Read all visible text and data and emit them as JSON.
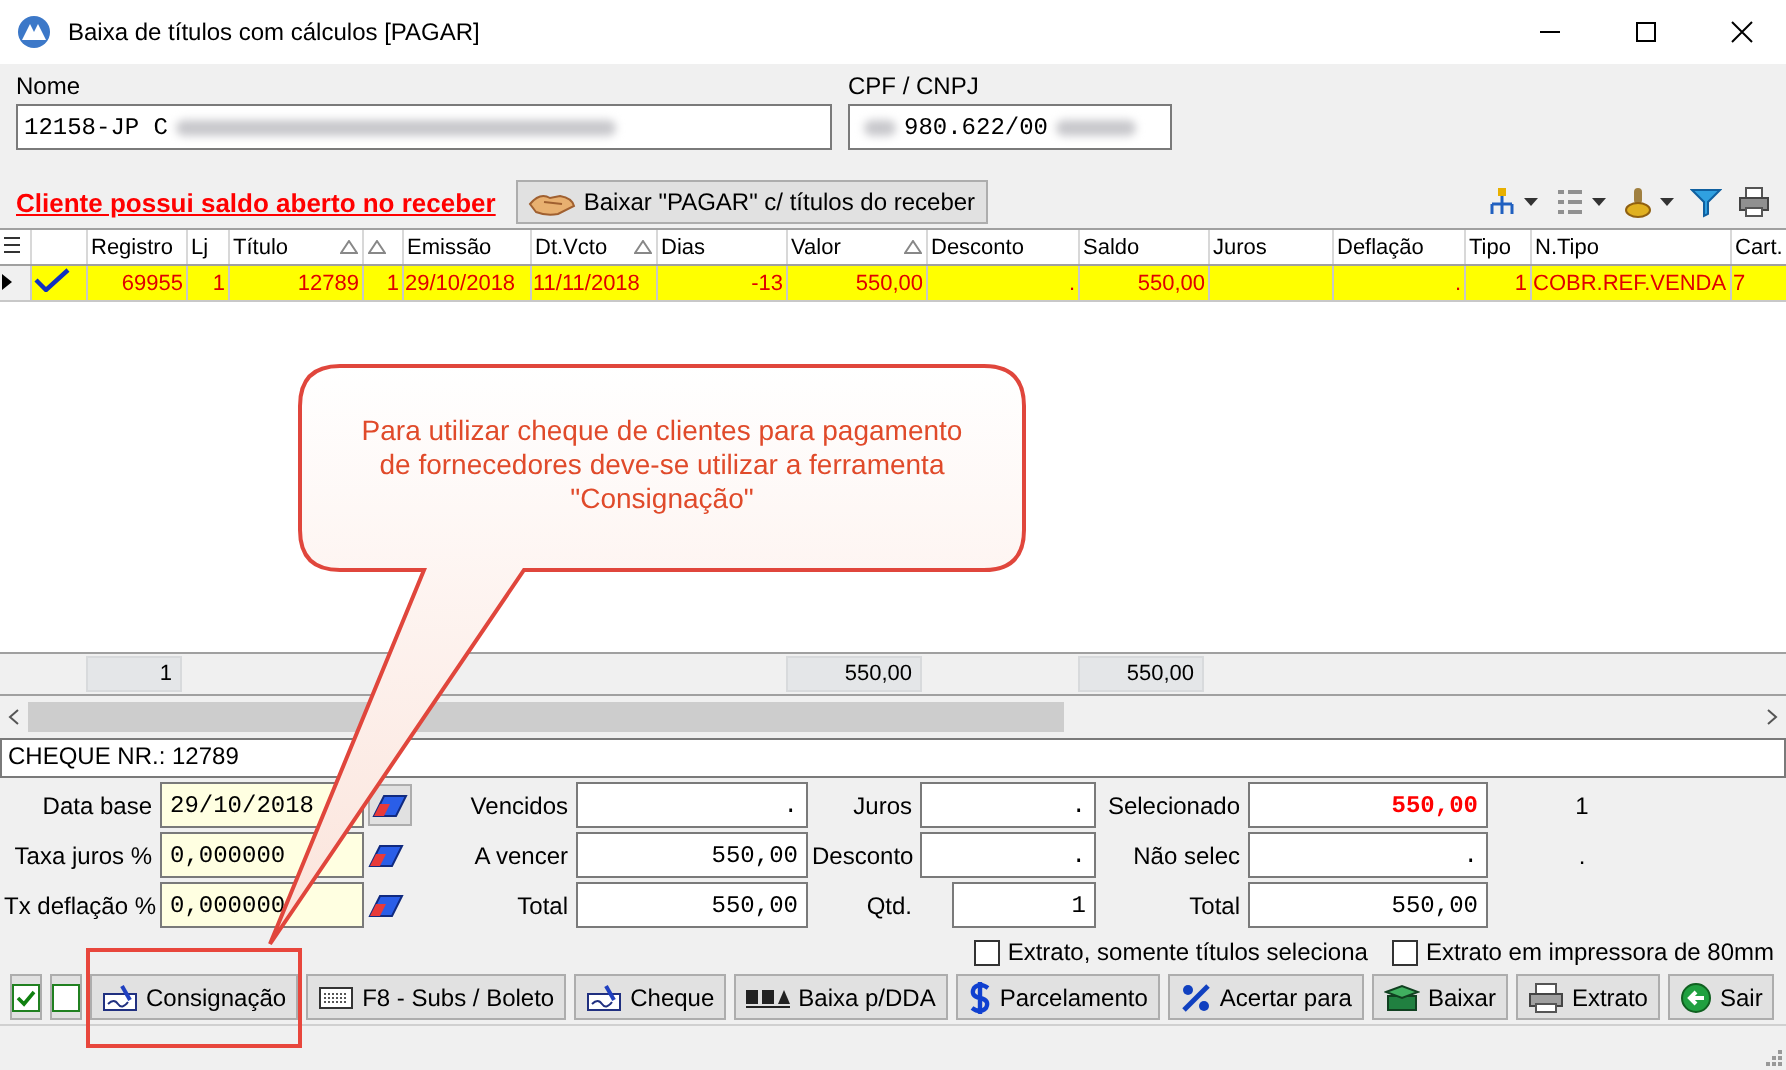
{
  "window": {
    "title": "Baixa de títulos com cálculos [PAGAR]"
  },
  "customer": {
    "name_label": "Nome",
    "name_value": "12158-JP C",
    "id_label": "CPF / CNPJ",
    "id_value": "980.622/00"
  },
  "alert": "Cliente possui saldo aberto no receber",
  "receivables_button": "Baixar \"PAGAR\" c/ títulos do receber",
  "table": {
    "columns": [
      {
        "label": "Registro",
        "sort": false,
        "total": "1"
      },
      {
        "label": "Lj",
        "sort": false
      },
      {
        "label": "Título",
        "sort": true
      },
      {
        "sort": true
      },
      {
        "label": "Emissão",
        "sort": false
      },
      {
        "label": "Dt.Vcto",
        "sort": true
      },
      {
        "label": "Dias",
        "sort": false
      },
      {
        "label": "Valor",
        "sort": true,
        "total": "550,00"
      },
      {
        "label": "Desconto",
        "sort": false
      },
      {
        "label": "Saldo",
        "sort": false,
        "total": "550,00"
      },
      {
        "label": "Juros",
        "sort": false
      },
      {
        "label": "Deflação",
        "sort": false
      },
      {
        "label": "Tipo",
        "sort": false
      },
      {
        "label": "N.Tipo",
        "sort": false
      },
      {
        "label": "Cart.",
        "sort": false
      }
    ],
    "rows": [
      {
        "selected": true,
        "checked": true,
        "cells": [
          "69955",
          "1",
          "12789",
          "1",
          "29/10/2018",
          "11/11/2018",
          "-13",
          "550,00",
          ".",
          "550,00",
          null,
          ".",
          "1",
          "COBR.REF.VENDA",
          "7"
        ]
      }
    ]
  },
  "cheque_line": "CHEQUE NR.: 12789",
  "rates": [
    {
      "label": "Data base",
      "value": "29/10/2018",
      "kind": "date"
    },
    {
      "label": "Taxa juros %",
      "value": "0,000000",
      "kind": "number"
    },
    {
      "label": "Tx deflação %",
      "value": "0,000000",
      "kind": "number"
    }
  ],
  "amounts": [
    {
      "label": "Vencidos",
      "value": "."
    },
    {
      "label": "A vencer",
      "value": "550,00"
    },
    {
      "label": "Total",
      "value": "550,00"
    }
  ],
  "adjustments": [
    {
      "label": "Juros",
      "value": ".",
      "kind": "wide"
    },
    {
      "label": "Desconto",
      "value": ".",
      "kind": "wide"
    },
    {
      "label": "Qtd.",
      "value": "1",
      "kind": "narrow"
    }
  ],
  "selection": [
    {
      "label": "Selecionado",
      "value": "550,00",
      "emphasis": true
    },
    {
      "label": "Não selec",
      "value": ".",
      "emphasis": false
    },
    {
      "label": "Total",
      "value": "550,00",
      "emphasis": false
    }
  ],
  "counts": [
    "1",
    "."
  ],
  "options": [
    {
      "label": "Extrato, somente títulos seleciona",
      "checked": false
    },
    {
      "label": "Extrato em impressora de 80mm",
      "checked": false
    }
  ],
  "toggles": [
    {
      "checked": true
    },
    {
      "checked": false
    }
  ],
  "buttons": [
    {
      "label": "Consignação",
      "highlighted": true
    },
    {
      "label": "F8 - Subs / Boleto",
      "highlighted": false
    },
    {
      "label": "Cheque",
      "highlighted": false
    },
    {
      "label": "Baixa p/DDA",
      "highlighted": false
    },
    {
      "label": "Parcelamento",
      "highlighted": false
    },
    {
      "label": "Acertar para",
      "highlighted": false
    },
    {
      "label": "Baixar",
      "highlighted": false
    },
    {
      "label": "Extrato",
      "highlighted": false
    },
    {
      "label": "Sair",
      "highlighted": false
    }
  ],
  "callout": {
    "text": "Para utilizar cheque de clientes para pagamento de fornecedores deve-se utilizar a ferramenta \"Consignação\""
  }
}
